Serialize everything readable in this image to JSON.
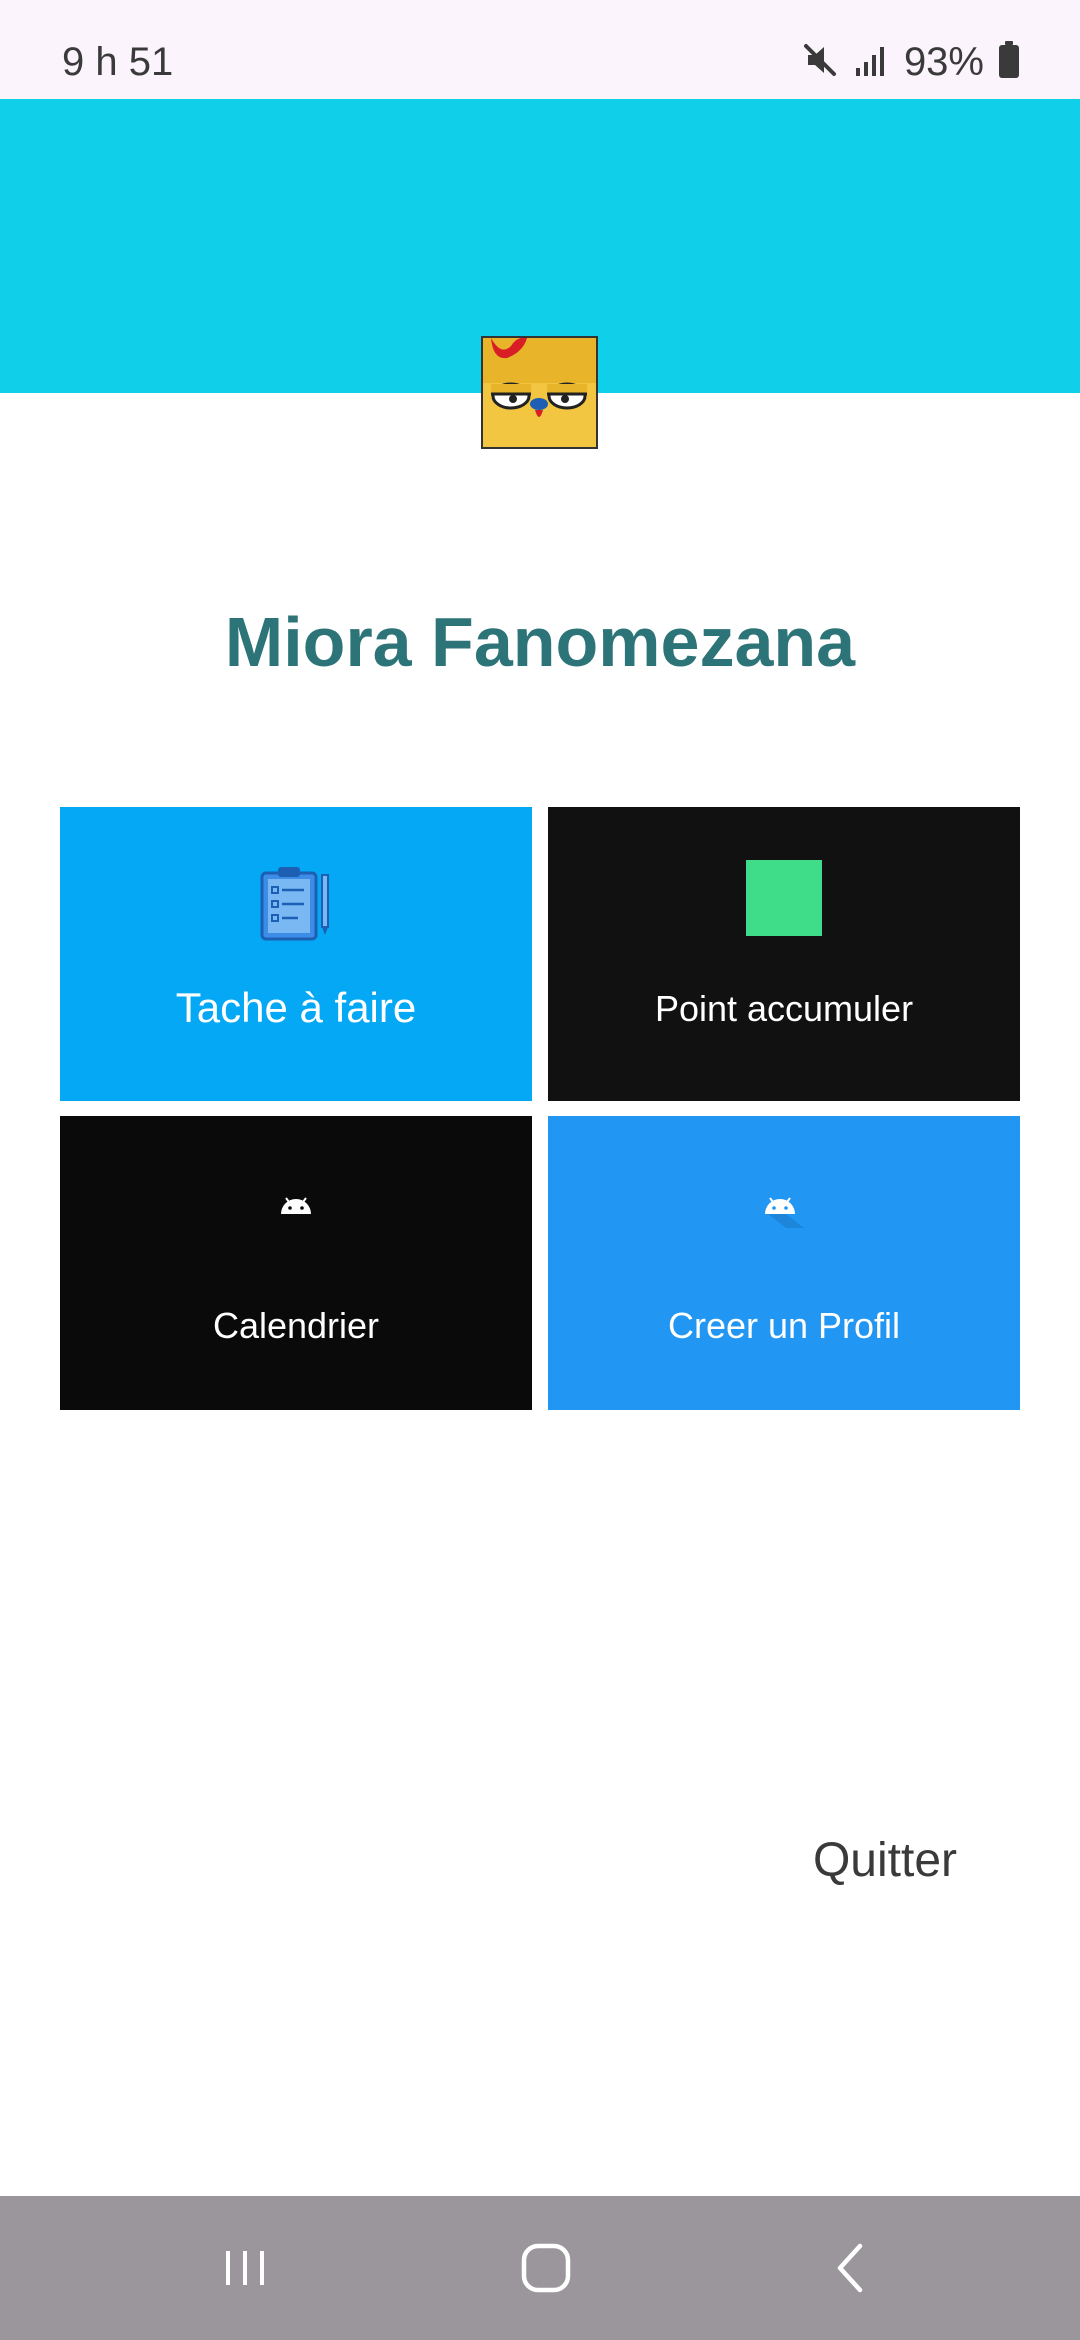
{
  "status_bar": {
    "time": "9 h 51",
    "battery": "93%",
    "icons": [
      "mute-icon",
      "signal-icon",
      "battery-icon"
    ]
  },
  "header": {
    "background_color": "#0fd0e8",
    "avatar_icon": "chicken-avatar-icon"
  },
  "profile": {
    "name": "Miora Fanomezana",
    "name_color": "#2c7478"
  },
  "tiles": [
    {
      "label": "Tache à faire",
      "icon": "clipboard-icon",
      "color": "#05a8f4"
    },
    {
      "label": "Point accumuler",
      "icon": "green-square-icon",
      "color": "#111111"
    },
    {
      "label": "Calendrier",
      "icon": "android-icon",
      "color": "#0a0a0a"
    },
    {
      "label": "Creer un Profil",
      "icon": "android-icon",
      "color": "#2196f3"
    }
  ],
  "quit_label": "Quitter",
  "nav_bar": {
    "buttons": [
      "recent-apps-icon",
      "home-icon",
      "back-icon"
    ]
  }
}
